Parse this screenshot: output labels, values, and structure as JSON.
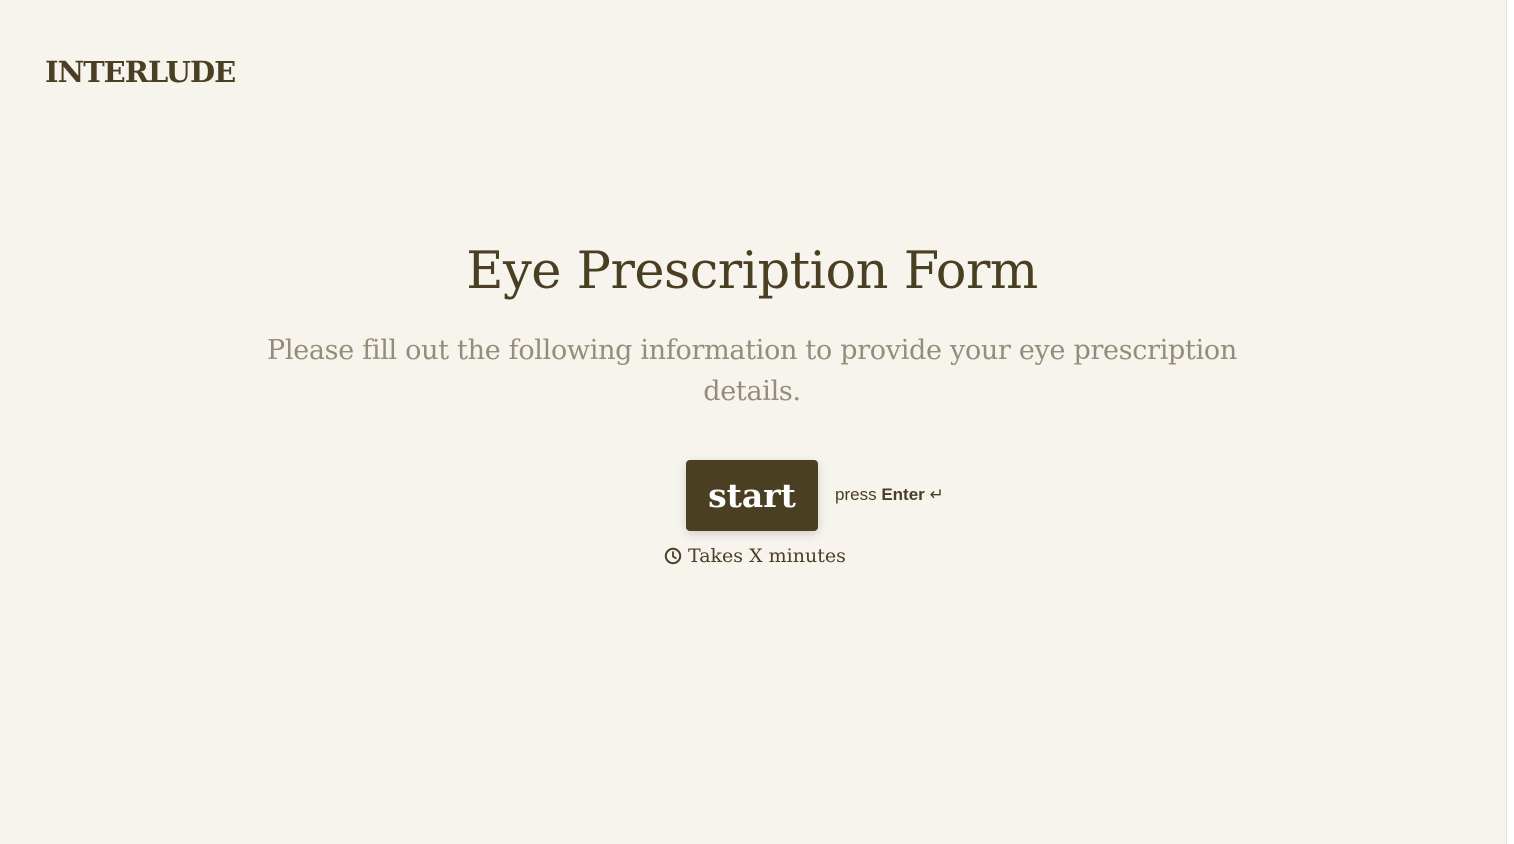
{
  "brand": {
    "logo_text": "INTERLUDE"
  },
  "form_intro": {
    "title": "Eye Prescription Form",
    "description": "Please fill out the following information to provide your eye prescription details.",
    "start_label": "start",
    "hint_prefix": "press",
    "hint_key": "Enter",
    "hint_icon": "↵",
    "duration_icon": "clock-icon",
    "duration_text": "Takes X minutes"
  },
  "colors": {
    "background": "#f7f3ed",
    "primary": "#4a3f22",
    "muted_text": "#958d7b",
    "button_text": "#ffffff"
  }
}
